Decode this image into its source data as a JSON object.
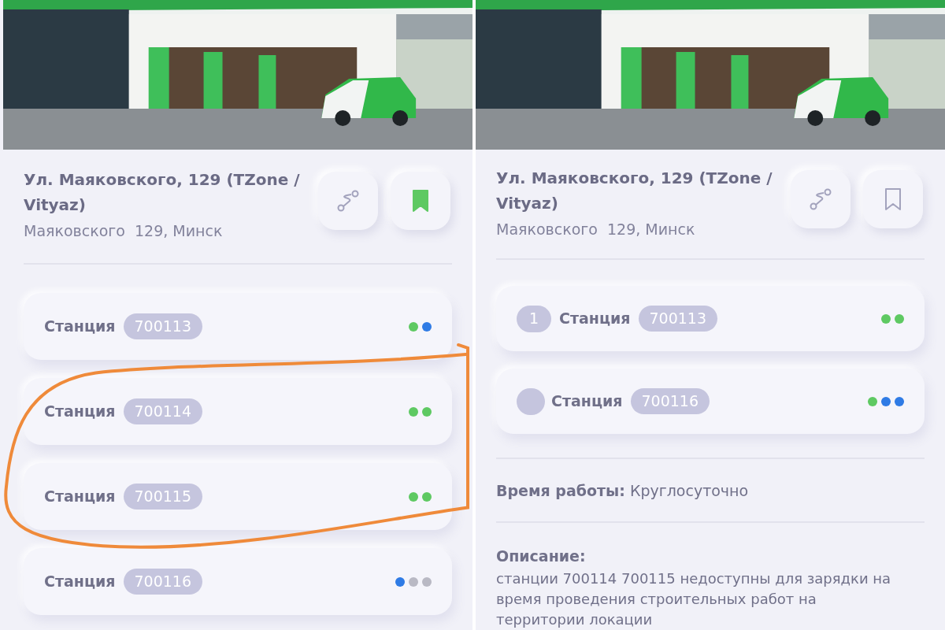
{
  "panels": [
    {
      "photo": {
        "kind": "picture"
      },
      "title": "Ул. Маяковского, 129 (TZone / Vityaz)",
      "address": "Маяковского  129, Минск",
      "bookmarked": true,
      "stations": [
        {
          "kind": "plain",
          "label": "Станция",
          "id": "700113",
          "highlighted": false,
          "dots": [
            {
              "color": "#5ec962"
            },
            {
              "color": "#2f7be5"
            }
          ]
        },
        {
          "kind": "plain",
          "label": "Станция",
          "id": "700114",
          "highlighted": true,
          "dots": [
            {
              "color": "#5ec962"
            },
            {
              "color": "#5ec962"
            }
          ]
        },
        {
          "kind": "plain",
          "label": "Станция",
          "id": "700115",
          "highlighted": true,
          "dots": [
            {
              "color": "#5ec962"
            },
            {
              "color": "#5ec962"
            }
          ]
        },
        {
          "kind": "plain",
          "label": "Станция",
          "id": "700116",
          "highlighted": false,
          "dots": [
            {
              "color": "#2f7be5"
            },
            {
              "color": "#b9b9c4"
            },
            {
              "color": "#b9b9c4"
            }
          ]
        }
      ]
    },
    {
      "photo": {
        "kind": "picture"
      },
      "title": "Ул. Маяковского, 129 (TZone / Vityaz)",
      "address": "Маяковского  129, Минск",
      "bookmarked": false,
      "stations": [
        {
          "kind": "numbered",
          "number": "1",
          "label": "Станция",
          "id": "700113",
          "highlighted": false,
          "dots": [
            {
              "color": "#5ec962"
            },
            {
              "color": "#5ec962"
            }
          ]
        },
        {
          "kind": "blank_badge",
          "label": "Станция",
          "id": "700116",
          "highlighted": false,
          "dots": [
            {
              "color": "#5ec962"
            },
            {
              "color": "#2f7be5"
            },
            {
              "color": "#2f7be5"
            }
          ]
        }
      ],
      "hours": "**Время работы:** Круглосуточно",
      "description": {
        "label": "Описание:",
        "text": "станции 700114 700115 недоступны для зарядки на время проведения строительных работ на территории локации"
      }
    }
  ]
}
